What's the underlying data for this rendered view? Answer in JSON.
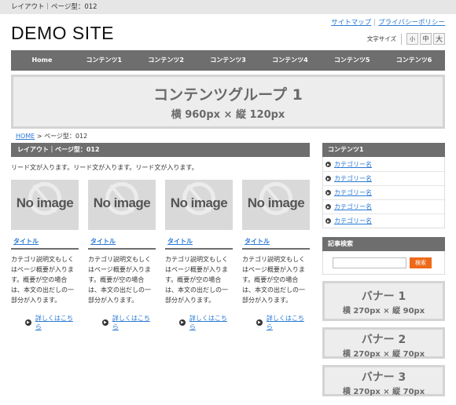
{
  "topbar": {
    "text": "レイアウト｜ページ型：012"
  },
  "site": {
    "logo": "DEMO SITE"
  },
  "toplinks": {
    "sitemap": "サイトマップ",
    "privacy": "プライバシーポリシー"
  },
  "fontsize": {
    "label": "文字サイズ",
    "small": "小",
    "medium": "中",
    "large": "大"
  },
  "gnav": [
    "Home",
    "コンテンツ1",
    "コンテンツ2",
    "コンテンツ3",
    "コンテンツ4",
    "コンテンツ5",
    "コンテンツ6"
  ],
  "hero": {
    "title": "コンテンツグループ 1",
    "subtitle": "横 960px × 縦 120px"
  },
  "breadcrumb": {
    "home": "HOME",
    "sep": " > ",
    "current": "ページ型：012"
  },
  "main": {
    "heading": "レイアウト｜ページ型：012",
    "lead": "リード文が入ります。リード文が入ります。リード文が入ります。",
    "cards": [
      {
        "image_text": "No image",
        "title": "タイトル",
        "desc": "カテゴリ説明文もしくはページ概要が入ります。概要が空の場合は、本文の出だしの一部分が入ります。",
        "more": "詳しくはこちら"
      },
      {
        "image_text": "No image",
        "title": "タイトル",
        "desc": "カテゴリ説明文もしくはページ概要が入ります。概要が空の場合は、本文の出だしの一部分が入ります。",
        "more": "詳しくはこちら"
      },
      {
        "image_text": "No image",
        "title": "タイトル",
        "desc": "カテゴリ説明文もしくはページ概要が入ります。概要が空の場合は、本文の出だしの一部分が入ります。",
        "more": "詳しくはこちら"
      },
      {
        "image_text": "No image",
        "title": "タイトル",
        "desc": "カテゴリ説明文もしくはページ概要が入ります。概要が空の場合は、本文の出だしの一部分が入ります。",
        "more": "詳しくはこちら"
      }
    ]
  },
  "sidebar": {
    "category_heading": "コンテンツ1",
    "categories": [
      "カテゴリー名",
      "カテゴリー名",
      "カテゴリー名",
      "カテゴリー名",
      "カテゴリー名"
    ],
    "search_heading": "記事検索",
    "search_button": "検索",
    "banners": [
      {
        "title": "バナー 1",
        "size": "横 270px × 縦 90px"
      },
      {
        "title": "バナー 2",
        "size": "横 270px × 縦 70px"
      },
      {
        "title": "バナー 3",
        "size": "横 270px × 縦 70px"
      }
    ]
  },
  "colors": {
    "nav_bg": "#6e6e6e",
    "link": "#2a7ad4",
    "search_button": "#ee6a1a",
    "placeholder_bg": "#ededed"
  }
}
